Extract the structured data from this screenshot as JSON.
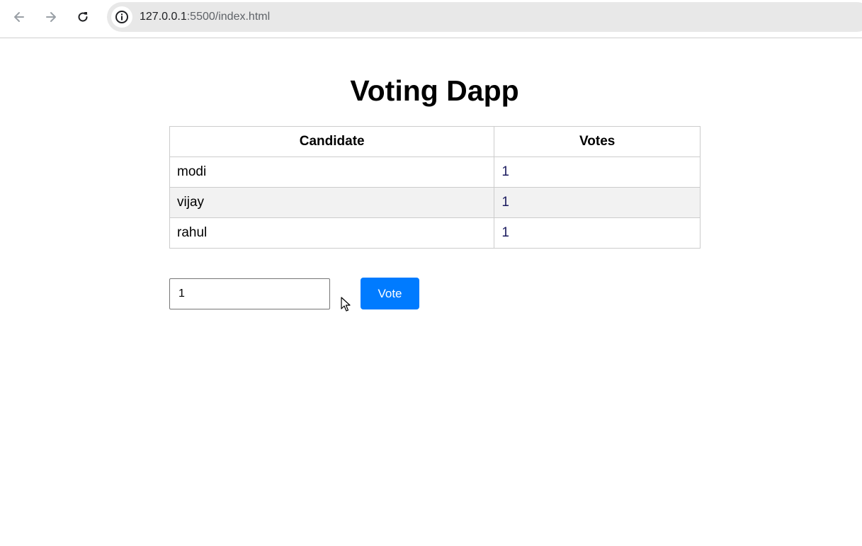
{
  "browser": {
    "url_host": "127.0.0.1",
    "url_rest": ":5500/index.html"
  },
  "page": {
    "title": "Voting Dapp"
  },
  "table": {
    "headers": [
      "Candidate",
      "Votes"
    ],
    "rows": [
      {
        "candidate": "modi",
        "votes": "1"
      },
      {
        "candidate": "vijay",
        "votes": "1"
      },
      {
        "candidate": "rahul",
        "votes": "1"
      }
    ]
  },
  "form": {
    "input_value": "1",
    "vote_label": "Vote"
  }
}
